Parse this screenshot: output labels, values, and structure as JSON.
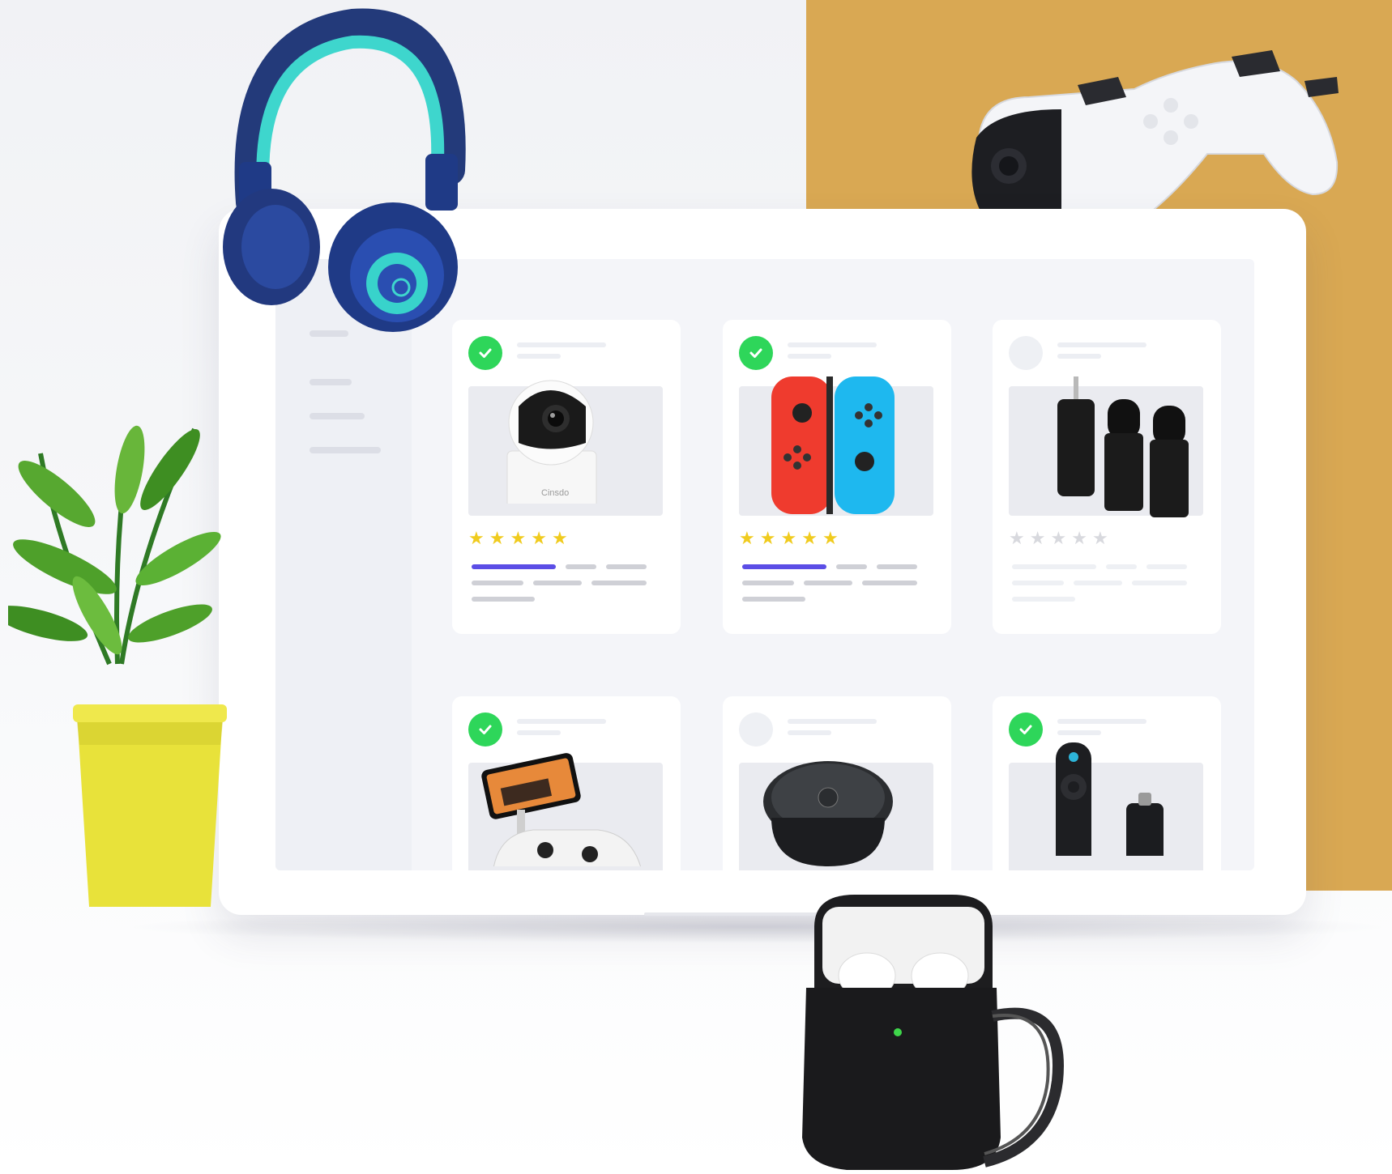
{
  "colors": {
    "gold_panel": "#d9a853",
    "check_badge": "#2ed65a",
    "star_active": "#f0cb1e",
    "star_inactive": "#d8d9de",
    "accent_bar": "#5b4ee6"
  },
  "product_cards": [
    {
      "product": "security-camera",
      "brand_text": "Cinsdo",
      "checked": true,
      "rating": 5,
      "rating_active": true
    },
    {
      "product": "joy-con-controllers",
      "checked": true,
      "rating": 5,
      "rating_active": true
    },
    {
      "product": "wireless-lavalier-mics",
      "checked": false,
      "rating": 5,
      "rating_active": false
    },
    {
      "product": "phone-controller-clip",
      "checked": true
    },
    {
      "product": "smart-ring-remote",
      "checked": false
    },
    {
      "product": "streaming-stick-remote",
      "checked": true
    }
  ],
  "decorations": [
    "headphones",
    "game-controller",
    "potted-plant",
    "earbuds-case"
  ]
}
